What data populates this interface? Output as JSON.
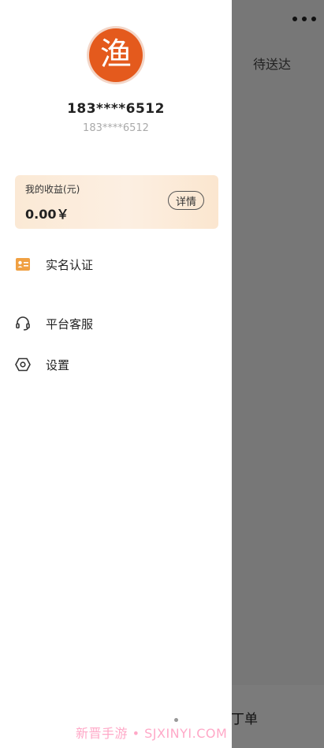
{
  "header": {
    "more_icon": "more-dots-icon"
  },
  "background_app": {
    "tab_pending": "待送达",
    "bottom_tab": "丁单"
  },
  "drawer": {
    "avatar_glyph": "渔",
    "user_name": "183****6512",
    "user_subtitle": "183****6512",
    "earnings": {
      "title": "我的收益(元)",
      "value": "0.00￥",
      "detail_button": "详情"
    },
    "menu": [
      {
        "label": "实名认证",
        "icon": "id-card-icon"
      },
      {
        "label": "平台客服",
        "icon": "headset-icon"
      },
      {
        "label": "设置",
        "icon": "settings-hexagon-icon"
      }
    ]
  },
  "watermark": "新晋手游 • SJXINYI.COM",
  "colors": {
    "avatar": "#e45a1d",
    "overlay": "#777777",
    "card_gradient": "#fbe9d5",
    "id_icon": "#f0a042"
  }
}
